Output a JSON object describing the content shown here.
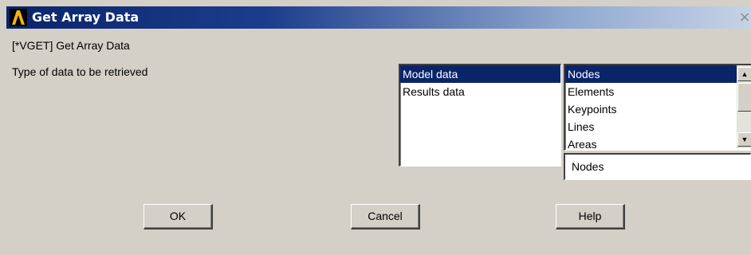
{
  "window": {
    "title": "Get Array Data",
    "close_glyph": "×"
  },
  "command_label": "[*VGET]  Get Array Data",
  "type_label": "Type of data to be retrieved",
  "data_category_list": {
    "items": [
      {
        "label": "Model data",
        "selected": true
      },
      {
        "label": "Results data",
        "selected": false
      }
    ]
  },
  "entity_list": {
    "items": [
      {
        "label": "Nodes",
        "selected": true
      },
      {
        "label": "Elements",
        "selected": false
      },
      {
        "label": "Keypoints",
        "selected": false
      },
      {
        "label": "Lines",
        "selected": false
      },
      {
        "label": "Areas",
        "selected": false
      }
    ],
    "scroll_up_glyph": "▲",
    "scroll_down_glyph": "▼"
  },
  "selection_field": {
    "value": "Nodes"
  },
  "buttons": {
    "ok": "OK",
    "cancel": "Cancel",
    "help": "Help"
  },
  "colors": {
    "dialog_bg": "#d4d0c8",
    "selection_bg": "#0a246a",
    "title_gradient_start": "#0a246a"
  },
  "icons": {
    "app": "ansys-logo-icon",
    "close": "close-icon"
  }
}
